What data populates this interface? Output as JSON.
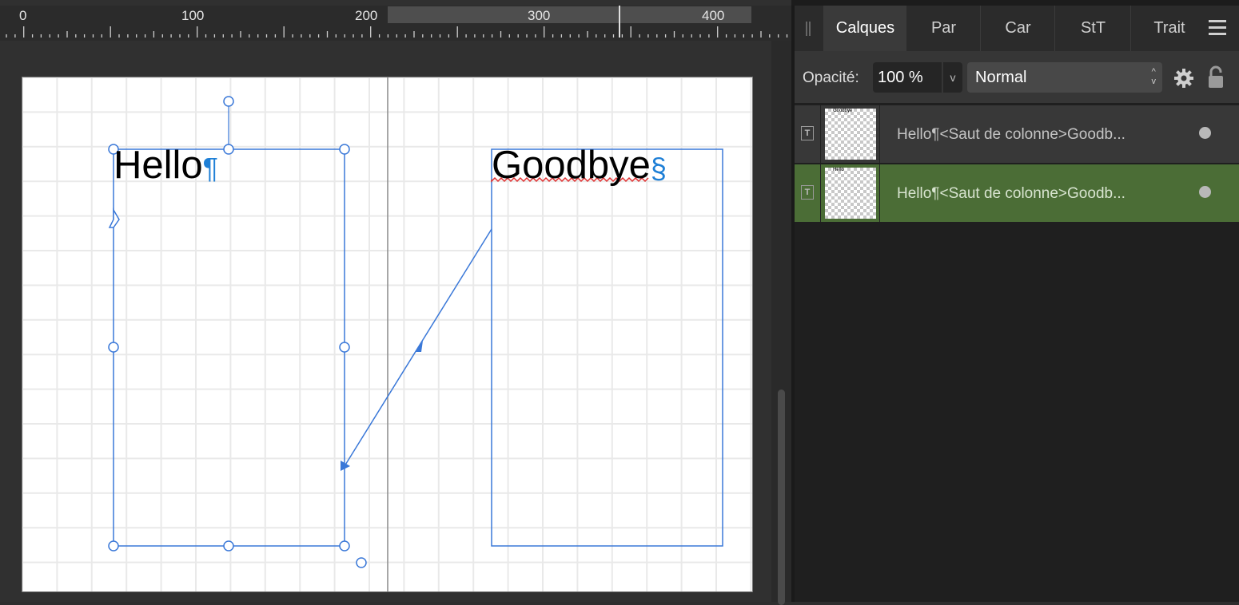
{
  "ruler": {
    "labels": [
      "0",
      "100",
      "200",
      "300",
      "400"
    ]
  },
  "canvas": {
    "text_left": "Hello",
    "text_left_mark": "¶",
    "text_right": "Goodbye",
    "text_right_mark": "§"
  },
  "panel": {
    "tabs": [
      "Calques",
      "Par",
      "Car",
      "StT",
      "Trait"
    ],
    "active_tab": "Calques",
    "opacity_label": "Opacité:",
    "opacity_value": "100 %",
    "blend_mode": "Normal",
    "layers": [
      {
        "name": "Hello¶<Saut de colonne>Goodb...",
        "thumb_text": "Goodbye",
        "selected": false
      },
      {
        "name": "Hello¶<Saut de colonne>Goodb...",
        "thumb_text": "Hello",
        "selected": true
      }
    ]
  },
  "colors": {
    "selection_blue": "#3a78d8",
    "selected_layer": "#4b6d36",
    "spell_underline": "#e03030"
  }
}
